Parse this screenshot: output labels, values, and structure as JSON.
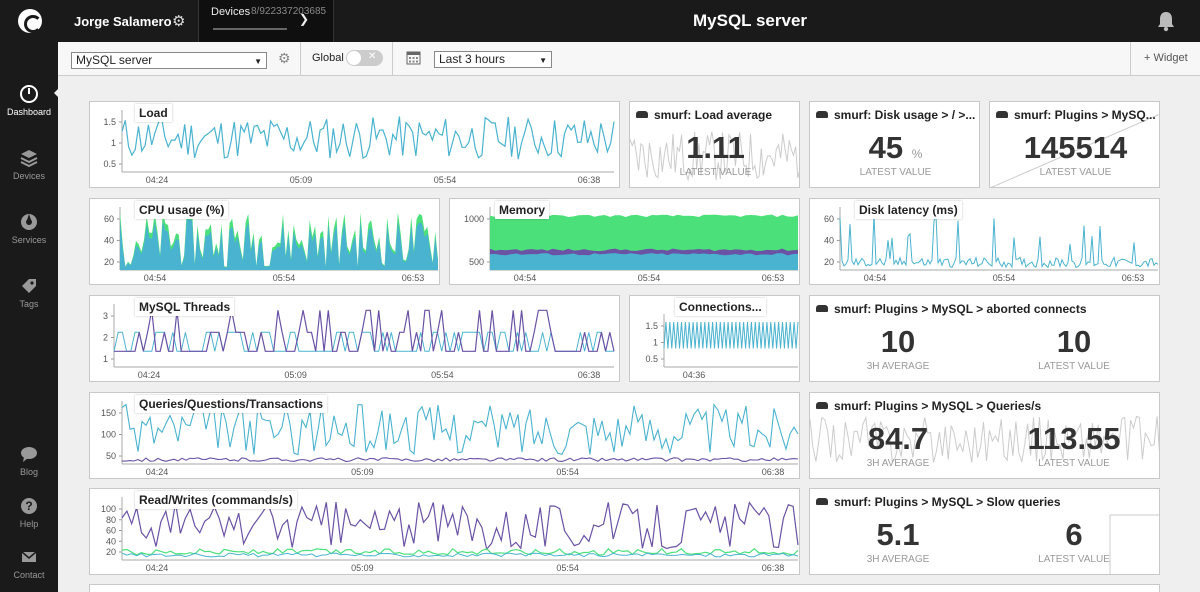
{
  "header": {
    "user_name": "Jorge Salamero",
    "devices_label": "Devices",
    "devices_count": "8/922337203685",
    "page_title": "MySQL server"
  },
  "sidebar": {
    "items": [
      {
        "label": "Dashboard",
        "icon": "dashboard-icon",
        "active": true
      },
      {
        "label": "Devices",
        "icon": "devices-icon"
      },
      {
        "label": "Services",
        "icon": "services-icon"
      },
      {
        "label": "Tags",
        "icon": "tag-icon"
      },
      {
        "label": "Blog",
        "icon": "chat-icon"
      },
      {
        "label": "Help",
        "icon": "help-icon"
      },
      {
        "label": "Contact",
        "icon": "mail-icon"
      }
    ]
  },
  "toolbar": {
    "dashboard_select": "MySQL server",
    "global_label": "Global",
    "time_range": "Last 3 hours",
    "add_widget": "+ Widget"
  },
  "colors": {
    "teal": "#4ab3cf",
    "purple": "#6a52a5",
    "green": "#4ce07a",
    "grey": "#cccccc"
  },
  "widgets": {
    "load": {
      "title": "Load",
      "y_ticks": [
        "1.5",
        "1",
        "0.5"
      ],
      "x_ticks": [
        "04:24",
        "05:09",
        "05:54",
        "06:38"
      ]
    },
    "load_avg": {
      "title": "smurf: Load average",
      "value": "1.11",
      "label": "LATEST VALUE"
    },
    "disk_usage": {
      "title": "smurf: Disk usage > / >...",
      "value": "45",
      "unit": "%",
      "label": "LATEST VALUE"
    },
    "plugins": {
      "title": "smurf: Plugins > MySQ...",
      "value": "145514",
      "label": "LATEST VALUE"
    },
    "cpu": {
      "title": "CPU usage (%)",
      "y_ticks": [
        "60",
        "40",
        "20"
      ],
      "x_ticks": [
        "04:54",
        "05:54",
        "06:53"
      ]
    },
    "memory": {
      "title": "Memory",
      "y_ticks": [
        "1000",
        "500"
      ],
      "x_ticks": [
        "04:54",
        "05:54",
        "06:53"
      ]
    },
    "disk_latency": {
      "title": "Disk latency (ms)",
      "y_ticks": [
        "60",
        "40",
        "20"
      ],
      "x_ticks": [
        "04:54",
        "05:54",
        "06:53"
      ]
    },
    "threads": {
      "title": "MySQL Threads",
      "y_ticks": [
        "3",
        "2",
        "1"
      ],
      "x_ticks": [
        "04:24",
        "05:09",
        "05:54",
        "06:38"
      ]
    },
    "connections": {
      "title": "Connections...",
      "y_ticks": [
        "1.5",
        "1",
        "0.5"
      ],
      "x_ticks": [
        "04:36"
      ]
    },
    "aborted": {
      "title": "smurf: Plugins > MySQL > aborted connects",
      "avg_value": "10",
      "avg_label": "3H AVERAGE",
      "latest_value": "10",
      "latest_label": "LATEST VALUE"
    },
    "queries": {
      "title": "Queries/Questions/Transactions",
      "y_ticks": [
        "150",
        "100",
        "50"
      ],
      "x_ticks": [
        "04:24",
        "05:09",
        "05:54",
        "06:38"
      ]
    },
    "queries_s": {
      "title": "smurf: Plugins > MySQL > Queries/s",
      "avg_value": "84.7",
      "avg_label": "3H AVERAGE",
      "latest_value": "113.55",
      "latest_label": "LATEST VALUE"
    },
    "rw": {
      "title": "Read/Writes (commands/s)",
      "y_ticks": [
        "100",
        "80",
        "60",
        "40",
        "20"
      ],
      "x_ticks": [
        "04:24",
        "05:09",
        "05:54",
        "06:38"
      ]
    },
    "slow": {
      "title": "smurf: Plugins > MySQL > Slow queries",
      "avg_value": "5.1",
      "avg_label": "3H AVERAGE",
      "latest_value": "6",
      "latest_label": "LATEST VALUE"
    }
  }
}
